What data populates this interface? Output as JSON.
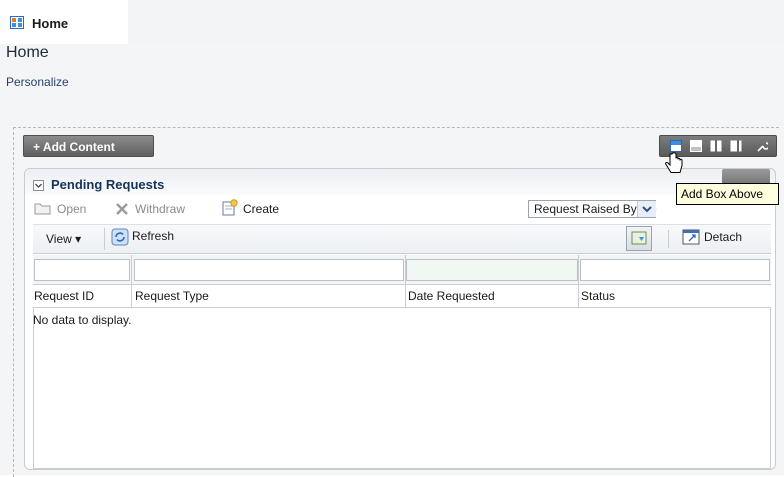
{
  "tab": {
    "label": "Home",
    "icon": "grid-icon"
  },
  "page": {
    "title": "Home",
    "personalize_link": "Personalize"
  },
  "toolbar": {
    "add_content": "+ Add Content"
  },
  "layout_buttons": [
    {
      "name": "add-box-above-icon"
    },
    {
      "name": "add-box-below-icon"
    },
    {
      "name": "two-column-icon"
    },
    {
      "name": "three-column-icon"
    },
    {
      "name": "wrench-icon"
    }
  ],
  "tooltip": {
    "text": "Add Box Above"
  },
  "panel": {
    "title": "Pending Requests",
    "actions": {
      "open": "Open",
      "withdraw": "Withdraw",
      "create": "Create"
    },
    "select": {
      "value": "Request Raised By Me"
    },
    "toolbar2": {
      "view": "View ▾",
      "refresh": "Refresh",
      "detach": "Detach"
    },
    "table": {
      "columns": [
        "Request ID",
        "Request Type",
        "Date Requested",
        "Status"
      ],
      "empty_message": "No data to display."
    }
  },
  "colors": {
    "accent": "#24436b",
    "panel_title": "#16335a",
    "tooltip_bg": "#ffffe0"
  }
}
